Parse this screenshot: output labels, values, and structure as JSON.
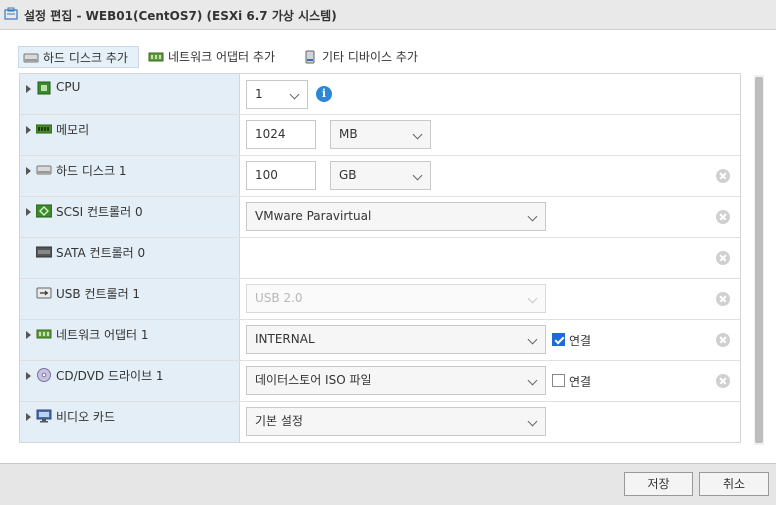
{
  "window": {
    "title": "설정 편집 - WEB01(CentOS7) (ESXi 6.7 가상 시스템)"
  },
  "toolbar": {
    "add_disk": "하드 디스크 추가",
    "add_nic": "네트워크 어댑터 추가",
    "add_other": "기타 디바이스 추가"
  },
  "rows": {
    "cpu": {
      "label": "CPU",
      "value": "1"
    },
    "memory": {
      "label": "메모리",
      "value": "1024",
      "unit": "MB"
    },
    "disk": {
      "label": "하드 디스크 1",
      "value": "100",
      "unit": "GB"
    },
    "scsi": {
      "label": "SCSI 컨트롤러 0",
      "value": "VMware Paravirtual"
    },
    "sata": {
      "label": "SATA 컨트롤러 0"
    },
    "usb": {
      "label": "USB 컨트롤러 1",
      "value": "USB 2.0"
    },
    "nic": {
      "label": "네트워크 어댑터 1",
      "value": "INTERNAL",
      "connect_label": "연결",
      "connected": true
    },
    "cdrom": {
      "label": "CD/DVD 드라이브 1",
      "value": "데이터스토어 ISO 파일",
      "connect_label": "연결",
      "connected": false
    },
    "video": {
      "label": "비디오 카드",
      "value": "기본 설정"
    }
  },
  "footer": {
    "save": "저장",
    "cancel": "취소"
  },
  "colors": {
    "accent": "#1e6bd6",
    "label_bg": "#e4eef6",
    "info": "#2e86d6"
  }
}
